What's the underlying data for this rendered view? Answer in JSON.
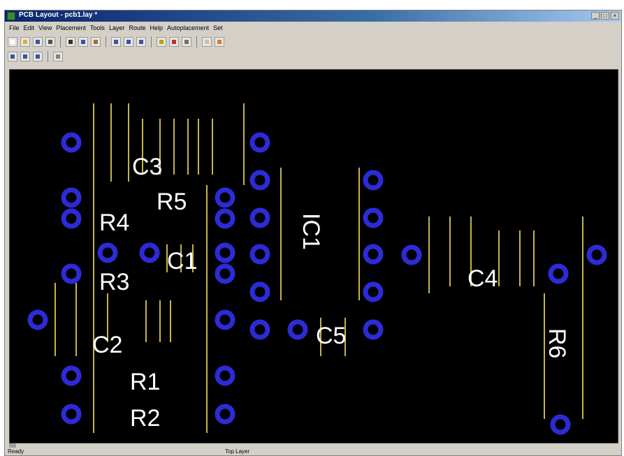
{
  "window": {
    "title": "PCB Layout - pcb1.lay *"
  },
  "menu": [
    "File",
    "Edit",
    "View",
    "Placement",
    "Tools",
    "Layer",
    "Route",
    "Help",
    "Autoplacement",
    "Set"
  ],
  "toolbars": {
    "row1": [
      "new-icon",
      "open-icon",
      "save-icon",
      "print-icon",
      "cut-icon",
      "copy-icon",
      "paste-icon",
      "undo-icon",
      "redo-icon",
      "route-icon",
      "wire-icon",
      "delete-icon",
      "zoom-icon",
      "grid-icon",
      "help-icon"
    ],
    "row2": [
      "zoom-in-icon",
      "zoom-out-icon",
      "zoom-fit-icon",
      "select-icon"
    ]
  },
  "colors": {
    "canvas_bg": "#000000",
    "pad": "#2d2bd6",
    "pad_hole": "#000000",
    "silkscreen": "#c8b44a",
    "label": "#ffffff"
  },
  "board": {
    "labels": [
      "C3",
      "R5",
      "R4",
      "C1",
      "R3",
      "IC1",
      "C4",
      "C5",
      "C2",
      "R1",
      "R2",
      "R6"
    ]
  },
  "status": {
    "left": "Ready",
    "mid1": "Top Layer",
    "mid2": "",
    "mid3": "",
    "right": ""
  }
}
